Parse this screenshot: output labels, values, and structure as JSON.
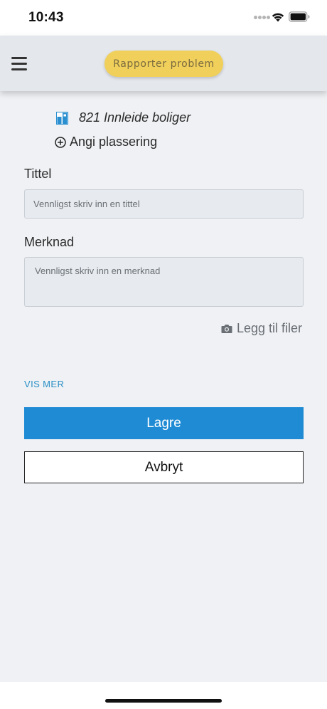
{
  "status_bar": {
    "time": "10:43"
  },
  "header": {
    "report_button_label": "Rapporter problem",
    "report_button_color": "#f0d05a"
  },
  "location": {
    "building_name": "821 Innleide boliger",
    "set_location_label": "Angi plassering"
  },
  "form": {
    "title_label": "Tittel",
    "title_placeholder": "Vennligst skriv inn en tittel",
    "title_value": "",
    "note_label": "Merknad",
    "note_placeholder": "Vennligst skriv inn en merknad",
    "note_value": "",
    "attach_label": "Legg til filer",
    "show_more_label": "VIS MER"
  },
  "actions": {
    "save_label": "Lagre",
    "cancel_label": "Avbryt",
    "primary_color": "#1e8bd4"
  },
  "icons": {
    "menu": "hamburger-menu-icon",
    "building": "building-icon",
    "add_location": "plus-circle-icon",
    "attach": "camera-icon",
    "wifi": "wifi-icon",
    "battery": "battery-icon"
  }
}
